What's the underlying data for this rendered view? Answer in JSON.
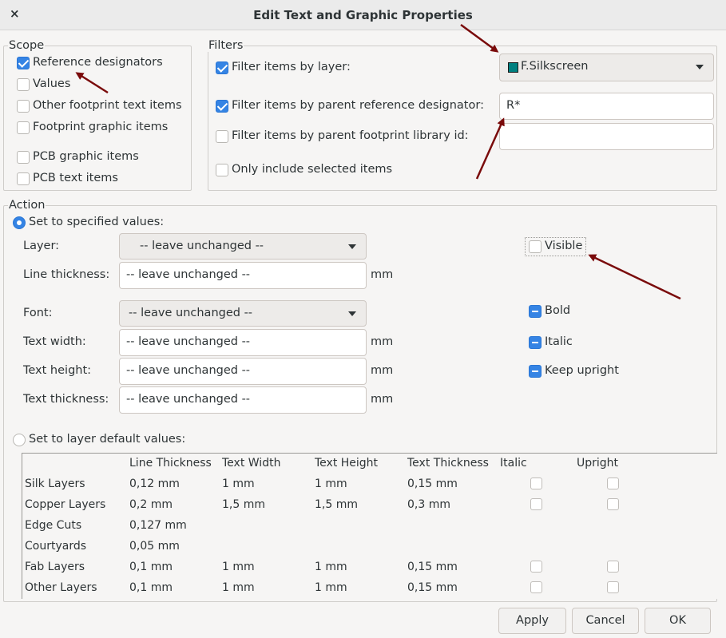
{
  "window": {
    "title": "Edit Text and Graphic Properties",
    "close_glyph": "×"
  },
  "scope": {
    "label": "Scope",
    "items": [
      {
        "label": "Reference designators",
        "checked": true
      },
      {
        "label": "Values",
        "checked": false
      },
      {
        "label": "Other footprint text items",
        "checked": false
      },
      {
        "label": "Footprint graphic items",
        "checked": false
      },
      {
        "label": "PCB graphic items",
        "checked": false
      },
      {
        "label": "PCB text items",
        "checked": false
      }
    ]
  },
  "filters": {
    "label": "Filters",
    "by_layer": {
      "label": "Filter items by layer:",
      "checked": true,
      "value": "F.Silkscreen",
      "swatch_color": "#008080"
    },
    "by_ref": {
      "label": "Filter items by parent reference designator:",
      "checked": true,
      "value": "R*"
    },
    "by_lib": {
      "label": "Filter items by parent footprint library id:",
      "checked": false,
      "value": ""
    },
    "selected_only": {
      "label": "Only include selected items",
      "checked": false
    }
  },
  "action": {
    "label": "Action",
    "set_specified": {
      "label": "Set to specified values:",
      "selected": true
    },
    "layer": {
      "label": "Layer:",
      "value": "-- leave unchanged --"
    },
    "visible": {
      "label": "Visible",
      "checked": false
    },
    "line_thickness": {
      "label": "Line thickness:",
      "value": "-- leave unchanged --",
      "unit": "mm"
    },
    "font": {
      "label": "Font:",
      "value": "-- leave unchanged --"
    },
    "bold": {
      "label": "Bold",
      "state": "mixed"
    },
    "text_width": {
      "label": "Text width:",
      "value": "-- leave unchanged --",
      "unit": "mm"
    },
    "italic": {
      "label": "Italic",
      "state": "mixed"
    },
    "text_height": {
      "label": "Text height:",
      "value": "-- leave unchanged --",
      "unit": "mm"
    },
    "keep_upright": {
      "label": "Keep upright",
      "state": "mixed"
    },
    "text_thickness": {
      "label": "Text thickness:",
      "value": "-- leave unchanged --",
      "unit": "mm"
    },
    "set_default": {
      "label": "Set to layer default values:",
      "selected": false
    }
  },
  "defaults_table": {
    "columns": [
      "Line Thickness",
      "Text Width",
      "Text Height",
      "Text Thickness",
      "Italic",
      "Upright"
    ],
    "rows": [
      {
        "name": "Silk Layers",
        "line": "0,12 mm",
        "width": "1 mm",
        "height": "1 mm",
        "thickness": "0,15 mm",
        "has_checks": true
      },
      {
        "name": "Copper Layers",
        "line": "0,2 mm",
        "width": "1,5 mm",
        "height": "1,5 mm",
        "thickness": "0,3 mm",
        "has_checks": true
      },
      {
        "name": "Edge Cuts",
        "line": "0,127 mm",
        "width": "",
        "height": "",
        "thickness": "",
        "has_checks": false
      },
      {
        "name": "Courtyards",
        "line": "0,05 mm",
        "width": "",
        "height": "",
        "thickness": "",
        "has_checks": false
      },
      {
        "name": "Fab Layers",
        "line": "0,1 mm",
        "width": "1 mm",
        "height": "1 mm",
        "thickness": "0,15 mm",
        "has_checks": true
      },
      {
        "name": "Other Layers",
        "line": "0,1 mm",
        "width": "1 mm",
        "height": "1 mm",
        "thickness": "0,15 mm",
        "has_checks": true
      }
    ]
  },
  "buttons": {
    "apply": "Apply",
    "cancel": "Cancel",
    "ok": "OK"
  },
  "annotations": {
    "arrow_color": "#7a0b0b"
  }
}
